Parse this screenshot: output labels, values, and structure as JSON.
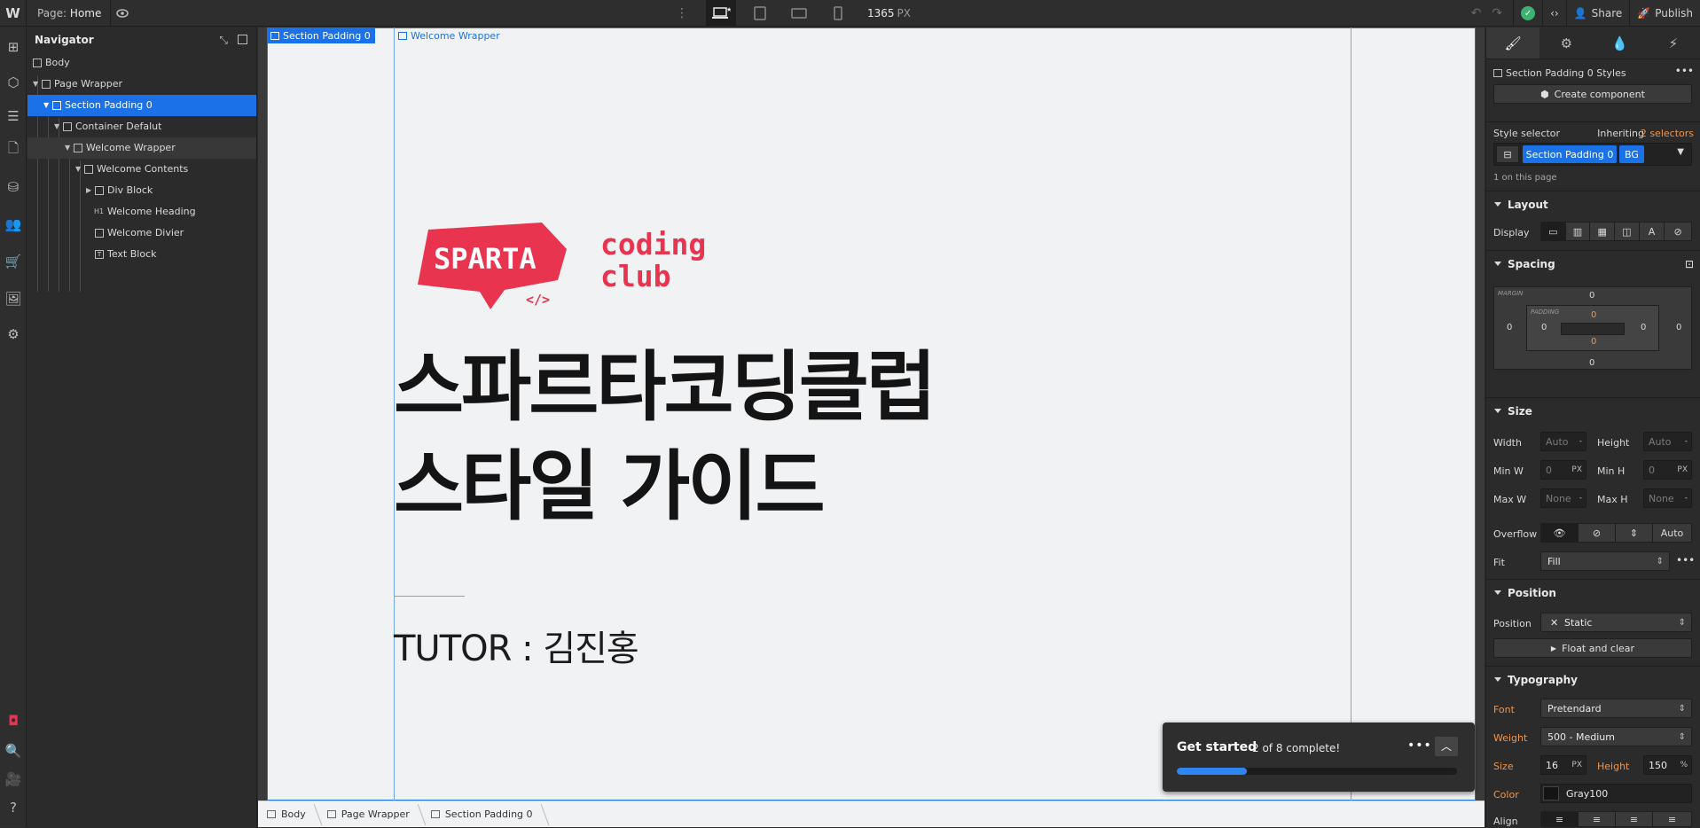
{
  "topbar": {
    "page_label": "Page:",
    "page_name": "Home",
    "viewport_width": "1365",
    "viewport_unit": "PX",
    "share": "Share",
    "publish": "Publish"
  },
  "navigator": {
    "title": "Navigator",
    "tree": [
      {
        "label": "Body",
        "level": 0
      },
      {
        "label": "Page Wrapper",
        "level": 1
      },
      {
        "label": "Section Padding 0",
        "level": 2
      },
      {
        "label": "Container Defalut",
        "level": 3
      },
      {
        "label": "Welcome Wrapper",
        "level": 4
      },
      {
        "label": "Welcome Contents",
        "level": 5
      },
      {
        "label": "Div Block",
        "level": 6
      },
      {
        "label": "Welcome Heading",
        "level": 6
      },
      {
        "label": "Welcome Divier",
        "level": 6
      },
      {
        "label": "Text Block",
        "level": 6
      }
    ]
  },
  "canvas": {
    "section_tag": "Section Padding 0",
    "wrapper_tag": "Welcome Wrapper",
    "logo_word": "SPARTA",
    "logo_sub1": "coding",
    "logo_sub2": "club",
    "logo_code": "</>",
    "heading_line1": "스파르타코딩클럽",
    "heading_line2": "스타일 가이드",
    "tutor": "TUTOR : 김진홍"
  },
  "get_started": {
    "title": "Get started",
    "progress_text": "2 of 8 complete!",
    "progress": 0.25
  },
  "breadcrumbs": [
    "Body",
    "Page Wrapper",
    "Section Padding 0"
  ],
  "style_panel": {
    "styles_title": "Section Padding 0 Styles",
    "create_component": "Create component",
    "style_selector": "Style selector",
    "inheriting": "Inheriting",
    "inheriting_count": "2 selectors",
    "selector_class": "Section Padding 0",
    "selector_combo": "BG",
    "on_page": "1 on this page",
    "layout": "Layout",
    "display": "Display",
    "spacing": "Spacing",
    "margin_label": "MARGIN",
    "padding_label": "PADDING",
    "margin": {
      "top": "0",
      "right": "0",
      "bottom": "0",
      "left": "0"
    },
    "padding": {
      "top": "0",
      "right": "0",
      "bottom": "0",
      "left": "0"
    },
    "size": "Size",
    "width": "Width",
    "width_val": "Auto",
    "width_unit": "-",
    "height": "Height",
    "height_val": "Auto",
    "height_unit": "-",
    "min_w": "Min W",
    "min_w_val": "0",
    "min_w_unit": "PX",
    "min_h": "Min H",
    "min_h_val": "0",
    "min_h_unit": "PX",
    "max_w": "Max W",
    "max_w_val": "None",
    "max_w_unit": "-",
    "max_h": "Max H",
    "max_h_val": "None",
    "max_h_unit": "-",
    "overflow": "Overflow",
    "overflow_auto": "Auto",
    "fit": "Fit",
    "fit_val": "Fill",
    "position_head": "Position",
    "position": "Position",
    "position_val": "Static",
    "float_clear": "Float and clear",
    "typography": "Typography",
    "font": "Font",
    "font_val": "Pretendard",
    "weight": "Weight",
    "weight_val": "500 - Medium",
    "size_lbl": "Size",
    "size_val": "16",
    "size_unit": "PX",
    "height_lbl": "Height",
    "lh_val": "150",
    "lh_unit": "%",
    "color": "Color",
    "color_val": "Gray100",
    "align": "Align"
  },
  "colors": {
    "accent": "#1b72e8",
    "brand": "#e8344e",
    "orange": "#f0954c"
  }
}
